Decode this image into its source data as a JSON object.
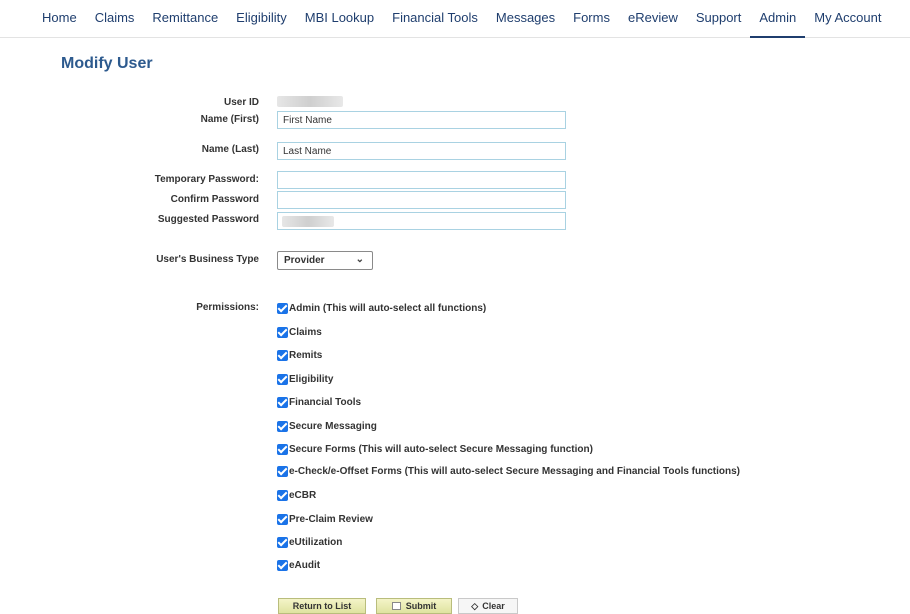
{
  "nav": {
    "items": [
      "Home",
      "Claims",
      "Remittance",
      "Eligibility",
      "MBI Lookup",
      "Financial Tools",
      "Messages",
      "Forms",
      "eReview",
      "Support",
      "Admin",
      "My Account"
    ],
    "active": "Admin"
  },
  "page": {
    "title": "Modify User"
  },
  "form": {
    "user_id_label": "User ID",
    "first_name_label": "Name (First)",
    "first_name_value": "First Name",
    "last_name_label": "Name (Last)",
    "last_name_value": "Last Name",
    "temp_password_label": "Temporary Password:",
    "confirm_password_label": "Confirm Password",
    "suggested_password_label": "Suggested Password",
    "business_type_label": "User's Business Type",
    "business_type_value": "Provider",
    "permissions_label": "Permissions:"
  },
  "permissions": [
    {
      "label": "Admin (This will auto-select all functions)",
      "checked": true
    },
    {
      "label": "Claims",
      "checked": true
    },
    {
      "label": "Remits",
      "checked": true
    },
    {
      "label": "Eligibility",
      "checked": true
    },
    {
      "label": "Financial Tools",
      "checked": true
    },
    {
      "label": "Secure Messaging",
      "checked": true
    },
    {
      "label": "Secure Forms (This will auto-select Secure Messaging function)",
      "checked": true
    },
    {
      "label": "e-Check/e-Offset Forms (This will auto-select Secure Messaging and Financial Tools functions)",
      "checked": true
    },
    {
      "label": "eCBR",
      "checked": true
    },
    {
      "label": "Pre-Claim Review",
      "checked": true
    },
    {
      "label": "eUtilization",
      "checked": true
    },
    {
      "label": "eAudit",
      "checked": true
    }
  ],
  "buttons": {
    "return_label": "Return to List",
    "submit_label": "Submit",
    "clear_label": "Clear"
  },
  "colors": {
    "nav_text": "#1f3e6e",
    "title": "#2d5a8e",
    "checkbox": "#1a73e8",
    "input_border": "#a9d2e2"
  }
}
